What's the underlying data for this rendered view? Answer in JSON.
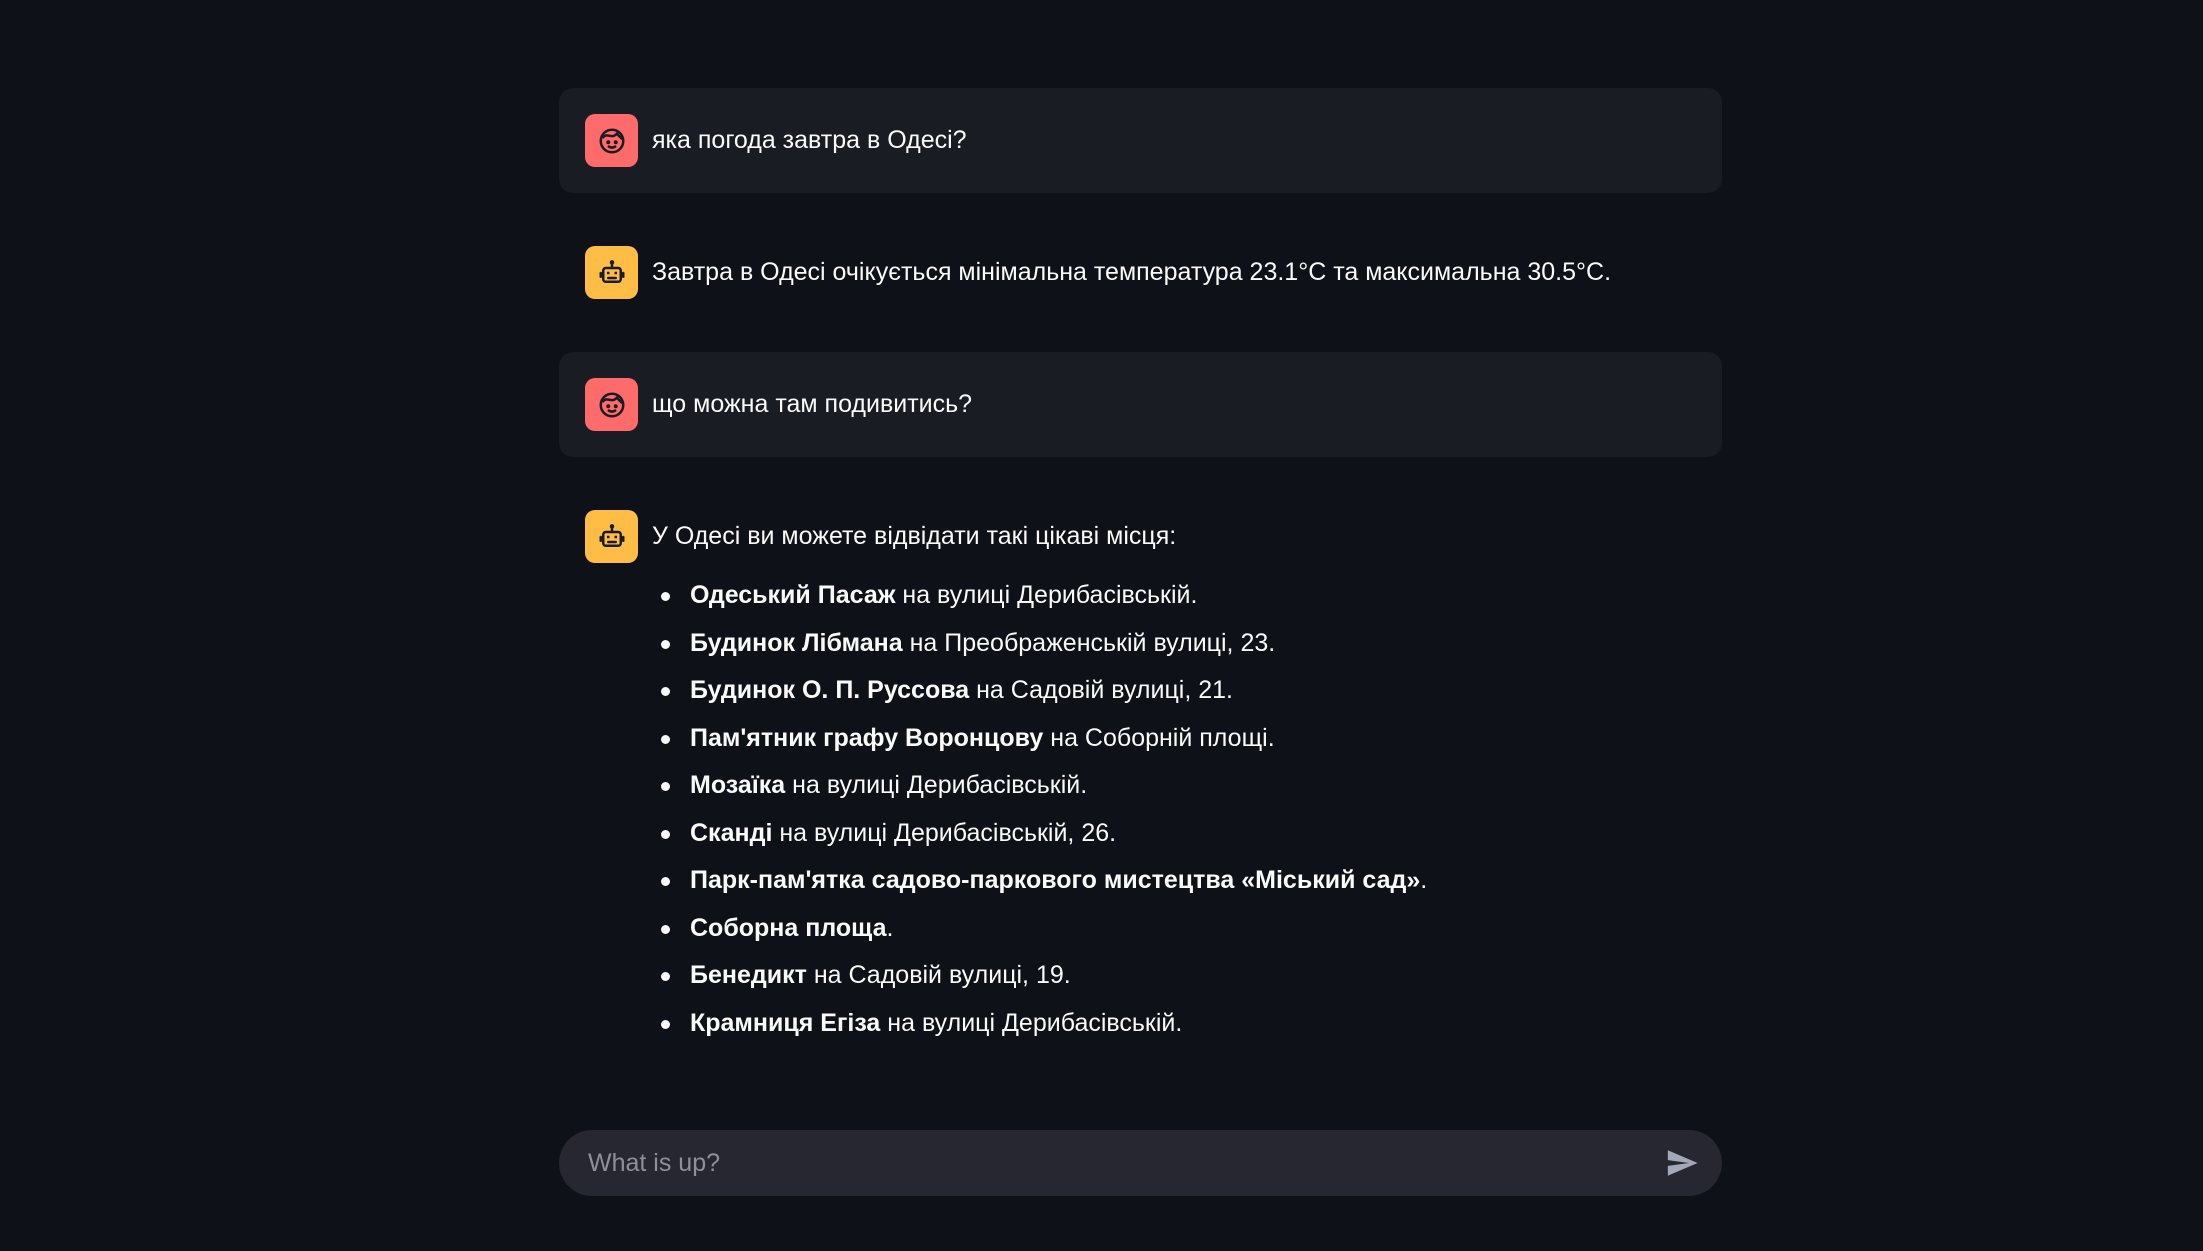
{
  "messages": [
    {
      "role": "user",
      "avatar_icon": "user-face-icon",
      "text": "яка погода завтра в Одесі?"
    },
    {
      "role": "assistant",
      "avatar_icon": "robot-icon",
      "text": "Завтра в Одесі очікується мінімальна температура 23.1°C та максимальна 30.5°C."
    },
    {
      "role": "user",
      "avatar_icon": "user-face-icon",
      "text": "що можна там подивитись?"
    },
    {
      "role": "assistant",
      "avatar_icon": "robot-icon",
      "intro": "У Одесі ви можете відвідати такі цікаві місця:",
      "places": [
        {
          "name": "Одеський Пасаж",
          "detail": " на вулиці Дерибасівській."
        },
        {
          "name": "Будинок Лібмана",
          "detail": " на Преображенській вулиці, 23."
        },
        {
          "name": "Будинок О. П. Руссова",
          "detail": " на Садовій вулиці, 21."
        },
        {
          "name": "Пам'ятник графу Воронцову",
          "detail": " на Соборній площі."
        },
        {
          "name": "Мозаїка",
          "detail": " на вулиці Дерибасівській."
        },
        {
          "name": "Сканді",
          "detail": " на вулиці Дерибасівській, 26."
        },
        {
          "name": "Парк-пам'ятка садово-паркового мистецтва «Міський сад»",
          "detail": "."
        },
        {
          "name": "Соборна площа",
          "detail": "."
        },
        {
          "name": "Бенедикт",
          "detail": " на Садовій вулиці, 19."
        },
        {
          "name": "Крамниця Егіза",
          "detail": " на вулиці Дерибасівській."
        }
      ]
    }
  ],
  "chat_input": {
    "placeholder": "What is up?",
    "value": ""
  },
  "colors": {
    "background": "#0e1117",
    "user_avatar": "#ff6b6b",
    "assistant_avatar": "#ffbd45",
    "user_bubble": "#1a1c24",
    "input_background": "#262730"
  },
  "icons": {
    "send": "send-arrow-icon"
  }
}
